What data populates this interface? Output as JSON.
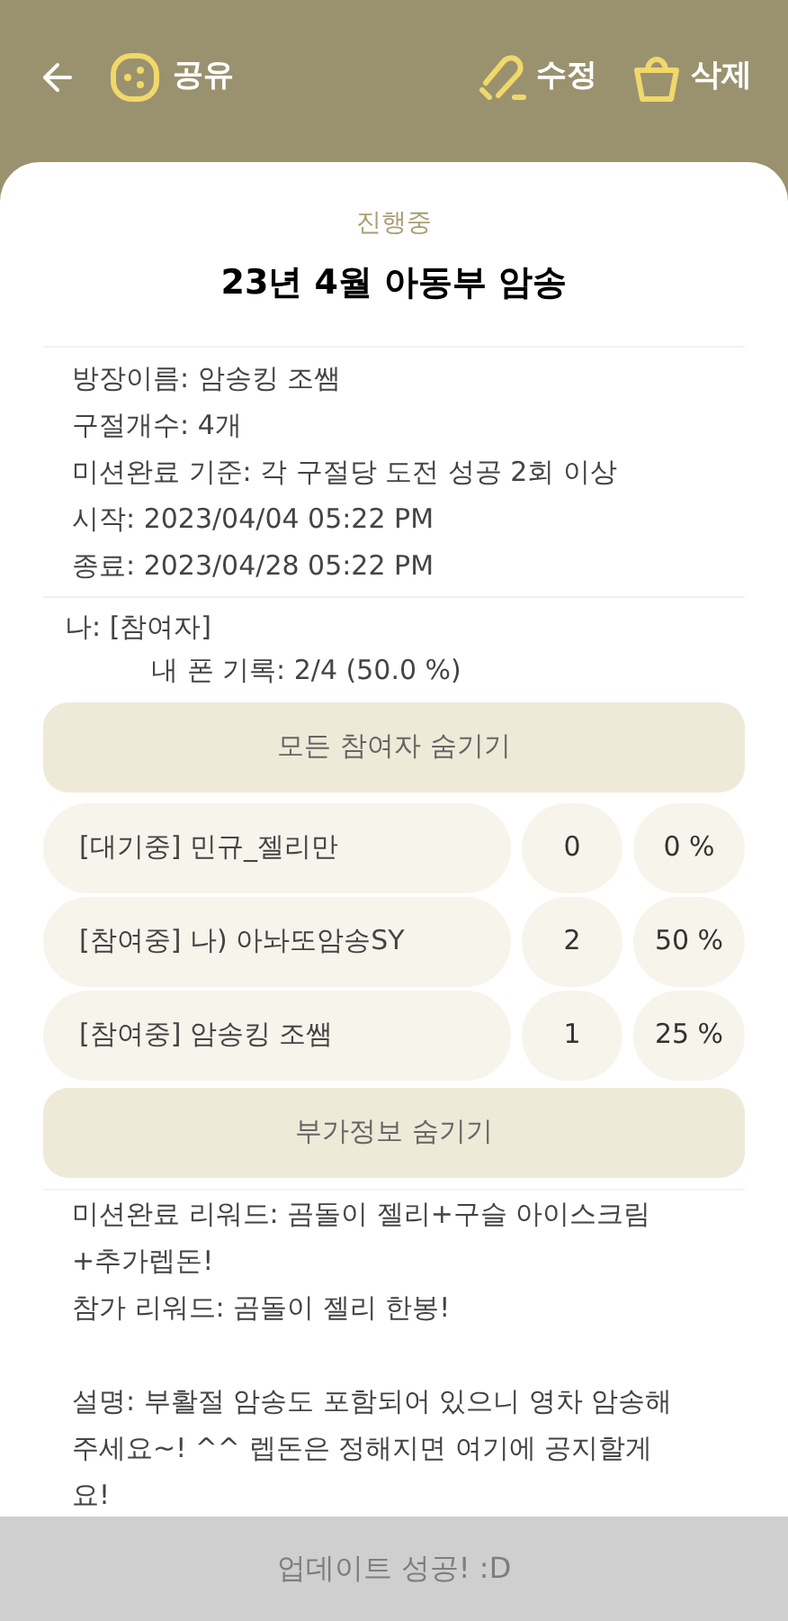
{
  "header": {
    "share": "공유",
    "edit": "수정",
    "delete": "삭제"
  },
  "status": "진행중",
  "title": "23년 4월 아동부 암송",
  "info": [
    "방장이름: 암송킹 조쌤",
    "구절개수: 4개",
    "미션완료 기준: 각 구절당 도전 성공 2회 이상",
    "시작: 2023/04/04 05:22 PM",
    "종료: 2023/04/28 05:22 PM"
  ],
  "me": {
    "role": "나:  [참여자]",
    "record": "내 폰 기록: 2/4 (50.0 %)"
  },
  "hide_participants_button": "모든 참여자 숨기기",
  "participants": [
    {
      "name": "[대기중] 민규_젤리만",
      "count": "0",
      "percent": "0 %"
    },
    {
      "name": "[참여중] 나) 아놔또암송SY",
      "count": "2",
      "percent": "50 %"
    },
    {
      "name": "[참여중] 암송킹 조쌤",
      "count": "1",
      "percent": "25 %"
    }
  ],
  "hide_extra_button": "부가정보 숨기기",
  "extra": [
    "미션완료 리워드: 곰돌이 젤리+구슬 아이스크림 +추가렙돈!",
    "참가 리워드: 곰돌이 젤리 한봉!"
  ],
  "description": "설명: 부활절 암송도 포함되어 있으니 영차 암송해 주세요~! ^^ 렙돈은 정해지면 여기에 공지할게요!",
  "toast": "업데이트 성공! :D"
}
